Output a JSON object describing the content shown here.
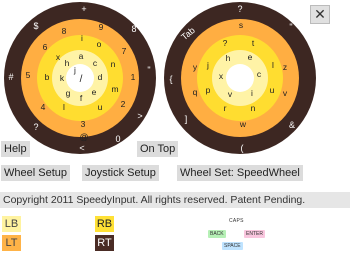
{
  "window": {
    "close_label": "✕"
  },
  "left_wheel": {
    "outer": [
      "+",
      "8",
      "\"",
      ">",
      "0",
      "<",
      "?",
      "#",
      "$"
    ],
    "ring2": [
      "9",
      "7",
      "1",
      "2",
      "3",
      "4",
      "5",
      "6",
      "8"
    ],
    "ring3": [
      "o",
      "i",
      "n",
      "m",
      "u",
      "l",
      "@",
      "b",
      "x"
    ],
    "ring4": [
      "a",
      "d",
      "c",
      "e",
      "g",
      "f",
      "k",
      "h",
      "j"
    ],
    "center_glyph": "/"
  },
  "right_wheel": {
    "outer": [
      "?",
      "\"",
      "&",
      "(",
      "]",
      "{",
      "Tab"
    ],
    "ring2": [
      "s",
      "z",
      "v",
      "w",
      "q",
      "y"
    ],
    "ring3": [
      "t",
      "l",
      "u",
      "n",
      "r",
      "p",
      "j",
      "?"
    ],
    "ring4": [
      "e",
      "c",
      "i",
      "v",
      "x",
      "h"
    ]
  },
  "buttons": {
    "help": "Help",
    "on_top": "On Top",
    "wheel_setup": "Wheel Setup",
    "joystick_setup": "Joystick Setup",
    "wheel_set": "Wheel Set: SpeedWheel"
  },
  "copyright": "Copyright 2011 SpeedyInput. All rights reserved. Patent Pending.",
  "triggers": {
    "lb": "LB",
    "lt": "LT",
    "rb": "RB",
    "rt": "RT"
  },
  "keys": {
    "caps": "CAPS",
    "back": "BACK",
    "enter": "ENTER",
    "space": "SPACE"
  },
  "colors": {
    "ring_outer": "#3d2722",
    "ring_2": "#ffae42",
    "ring_3": "#ffdd30",
    "ring_4": "#fff3a6",
    "center": "#ffffff",
    "text_light": "#ffffff",
    "text_dark": "#222222"
  }
}
